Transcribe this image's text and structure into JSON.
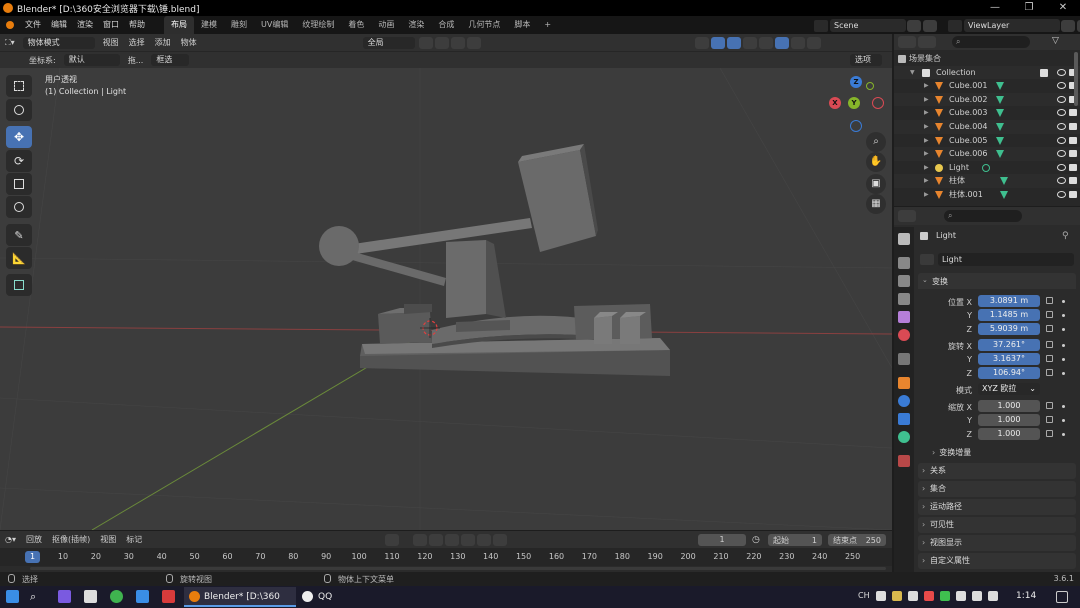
{
  "window": {
    "title": "Blender* [D:\\360安全浏览器下载\\锤.blend]",
    "controls": [
      "—",
      "❐",
      "✕"
    ]
  },
  "menubar": {
    "menus": [
      "文件",
      "编辑",
      "渲染",
      "窗口",
      "帮助"
    ],
    "workspaces": [
      "布局",
      "建模",
      "雕刻",
      "UV编辑",
      "纹理绘制",
      "着色",
      "动画",
      "渲染",
      "合成",
      "几何节点",
      "脚本"
    ],
    "active_workspace": "布局",
    "add_tab": "+",
    "scene": "Scene",
    "view_layer": "ViewLayer"
  },
  "viewport_header": {
    "mode": "物体模式",
    "menus": [
      "视图",
      "选择",
      "添加",
      "物体"
    ],
    "transform_orientation": "全局",
    "coord_label": "坐标系:",
    "coord_value": "默认",
    "drag_label": "拖...",
    "select_mode": "框选",
    "options": "选项"
  },
  "viewport": {
    "view_name": "用户透视",
    "collection_info": "(1) Collection | Light",
    "gizmo": {
      "x": "X",
      "y": "Y",
      "z": "Z"
    }
  },
  "outliner": {
    "search_placeholder": "",
    "root": "场景集合",
    "collection": "Collection",
    "items": [
      {
        "name": "Cube.001",
        "type": "mesh"
      },
      {
        "name": "Cube.002",
        "type": "mesh"
      },
      {
        "name": "Cube.003",
        "type": "mesh"
      },
      {
        "name": "Cube.004",
        "type": "mesh"
      },
      {
        "name": "Cube.005",
        "type": "mesh"
      },
      {
        "name": "Cube.006",
        "type": "mesh"
      },
      {
        "name": "Light",
        "type": "light"
      },
      {
        "name": "柱体",
        "type": "mesh"
      },
      {
        "name": "柱体.001",
        "type": "mesh"
      },
      {
        "name": "柱体.002",
        "type": "mesh"
      }
    ]
  },
  "properties": {
    "object_name": "Light",
    "data_name": "Light",
    "transform_panel": "变换",
    "location": {
      "label": "位置",
      "x": "3.0891 m",
      "y": "1.1485 m",
      "z": "5.9039 m"
    },
    "rotation": {
      "label": "旋转",
      "x": "37.261°",
      "y": "3.1637°",
      "z": "106.94°"
    },
    "mode_label": "模式",
    "mode_value": "XYZ 欧拉",
    "scale": {
      "label": "缩放",
      "x": "1.000",
      "y": "1.000",
      "z": "1.000"
    },
    "axis_x": "X",
    "axis_y": "Y",
    "axis_z": "Z",
    "delta_transform": "变换增量",
    "panels": [
      "关系",
      "集合",
      "运动路径",
      "可见性",
      "视图显示",
      "自定义属性"
    ]
  },
  "timeline": {
    "menus": [
      "回放",
      "抠像(插帧)",
      "视图",
      "标记"
    ],
    "current_frame": "1",
    "start_label": "起始",
    "start_value": "1",
    "end_label": "结束点",
    "end_value": "250",
    "ruler": [
      "10",
      "20",
      "30",
      "40",
      "50",
      "60",
      "70",
      "80",
      "90",
      "100",
      "110",
      "120",
      "130",
      "140",
      "150",
      "160",
      "170",
      "180",
      "190",
      "200",
      "210",
      "220",
      "230",
      "240",
      "250"
    ],
    "playhead": "1"
  },
  "statusbar": {
    "select": "选择",
    "rotate": "旋转视图",
    "context_menu": "物体上下文菜单",
    "version": "3.6.1"
  },
  "taskbar": {
    "apps": [
      "Blender* [D:\\360安...",
      "QQ"
    ],
    "tray": "CH",
    "clock": "1:14"
  },
  "colors": {
    "accent": "#4772b3",
    "blender_orange": "#e87d0d",
    "mesh_green": "#3fbf8f"
  }
}
